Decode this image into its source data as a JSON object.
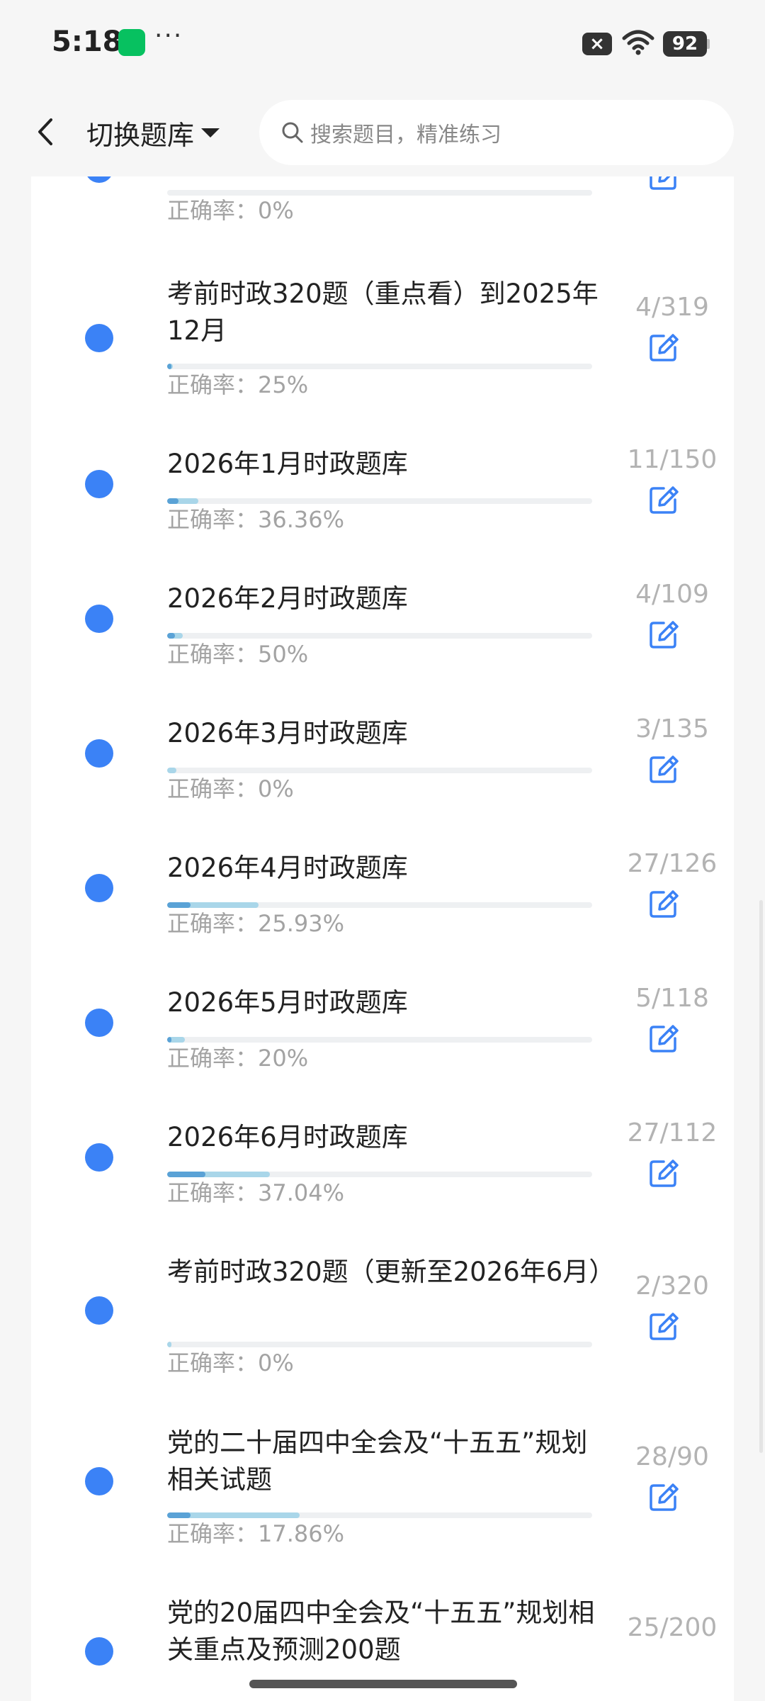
{
  "status_bar": {
    "time": "5:18",
    "dots": "···",
    "sim_badge": "×",
    "battery": "92"
  },
  "header": {
    "switch_label": "切换题库",
    "search_placeholder": "搜索题目，精准练习"
  },
  "rows": [
    {
      "title": "",
      "accuracy": "正确率：0%",
      "count": "",
      "done": null,
      "total": null,
      "accuracy_value": 0
    },
    {
      "title": "考前时政320题（重点看）到2025年12月",
      "accuracy": "正确率：25%",
      "count": "4/319",
      "done": 4,
      "total": 319,
      "accuracy_value": 0.25
    },
    {
      "title": "2026年1月时政题库",
      "accuracy": "正确率：36.36%",
      "count": "11/150",
      "done": 11,
      "total": 150,
      "accuracy_value": 0.3636
    },
    {
      "title": "2026年2月时政题库",
      "accuracy": "正确率：50%",
      "count": "4/109",
      "done": 4,
      "total": 109,
      "accuracy_value": 0.5
    },
    {
      "title": "2026年3月时政题库",
      "accuracy": "正确率：0%",
      "count": "3/135",
      "done": 3,
      "total": 135,
      "accuracy_value": 0
    },
    {
      "title": "2026年4月时政题库",
      "accuracy": "正确率：25.93%",
      "count": "27/126",
      "done": 27,
      "total": 126,
      "accuracy_value": 0.2593
    },
    {
      "title": "2026年5月时政题库",
      "accuracy": "正确率：20%",
      "count": "5/118",
      "done": 5,
      "total": 118,
      "accuracy_value": 0.2
    },
    {
      "title": "2026年6月时政题库",
      "accuracy": "正确率：37.04%",
      "count": "27/112",
      "done": 27,
      "total": 112,
      "accuracy_value": 0.3704
    },
    {
      "title": "考前时政320题（更新至2026年6月）",
      "accuracy": "正确率：0%",
      "count": "2/320",
      "done": 2,
      "total": 320,
      "accuracy_value": 0
    },
    {
      "title": "党的二十届四中全会及“十五五”规划相关试题",
      "accuracy": "正确率：17.86%",
      "count": "28/90",
      "done": 28,
      "total": 90,
      "accuracy_value": 0.1786
    },
    {
      "title": "党的20届四中全会及“十五五”规划相关重点及预测200题",
      "accuracy": "",
      "count": "25/200",
      "done": 25,
      "total": 200,
      "accuracy_value": null
    }
  ],
  "colors": {
    "dot": "#3b82f6",
    "progress_total": "#a9d6e9",
    "progress_correct": "#5aa2d6"
  }
}
